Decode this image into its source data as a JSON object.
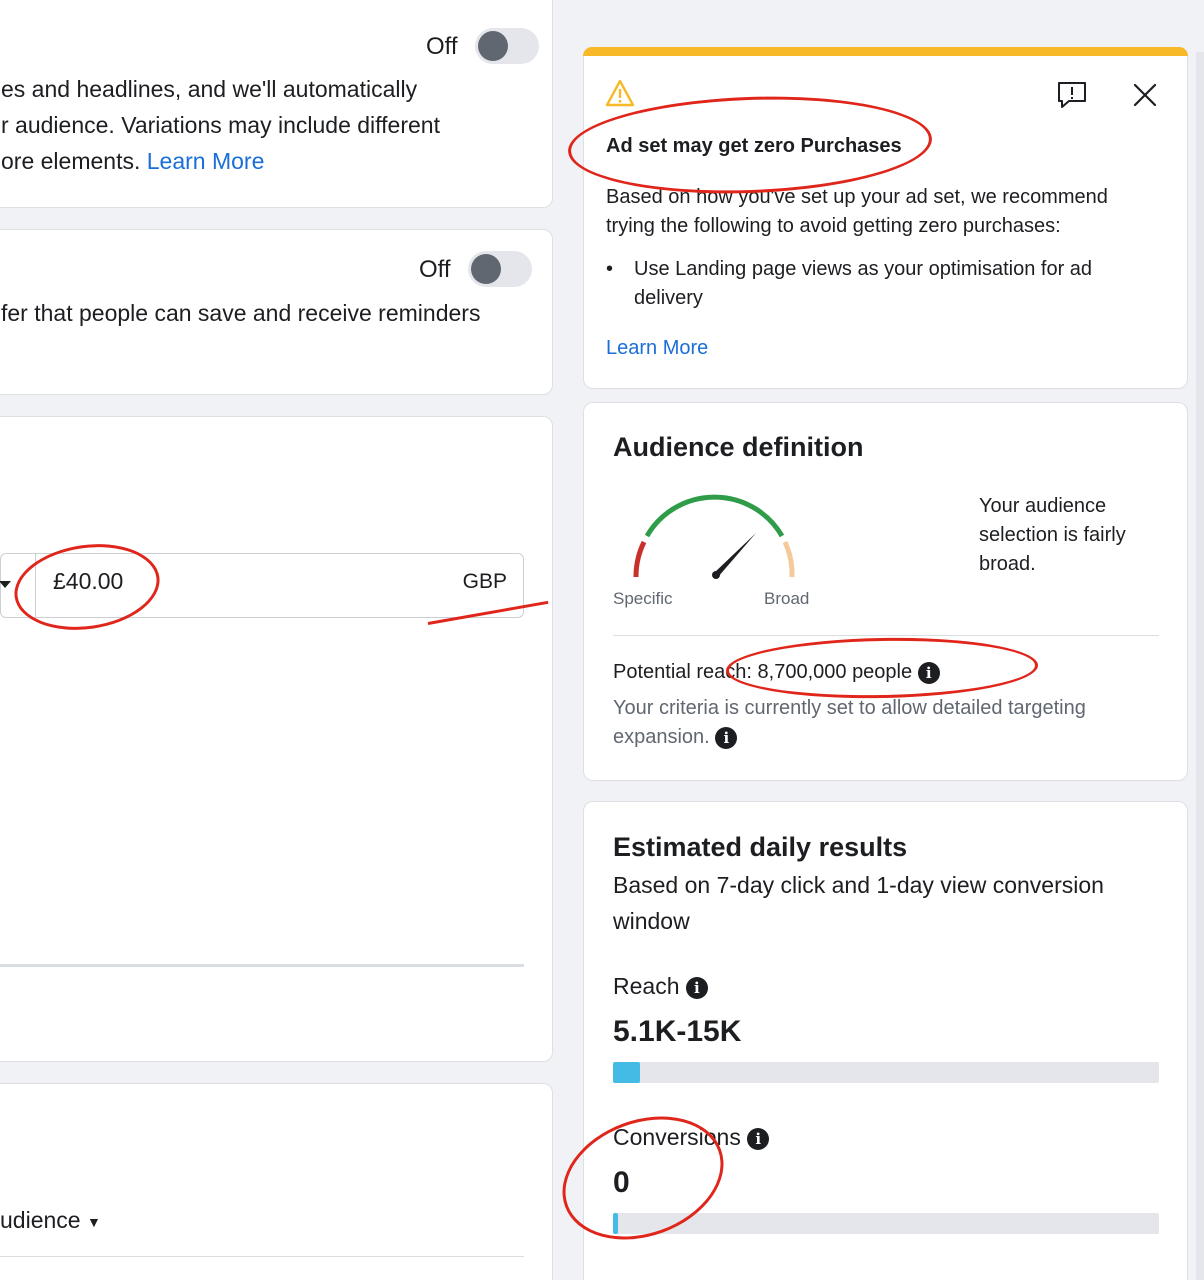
{
  "colors": {
    "accent": "#1877f2",
    "link": "#1a6ed8",
    "warning": "#f7b928",
    "annotation": "#e0261b",
    "bar_fill": "#44bbe5"
  },
  "dynamic_creative": {
    "toggle_label": "Off",
    "toggle_on": false,
    "line1": "es and headlines, and we'll automatically",
    "line2": "r audience. Variations may include different",
    "line3": "ore elements.",
    "learn_more": "Learn More"
  },
  "offer": {
    "toggle_label": "Off",
    "toggle_on": false,
    "line1": "fer that people can save and receive reminders"
  },
  "budget": {
    "value": "£40.00",
    "currency": "GBP"
  },
  "audience_section": {
    "dropdown_label": "udience"
  },
  "alert": {
    "icon": "warning-icon",
    "title": "Ad set may get zero Purchases",
    "body_line1": "Based on how you've set up your ad set, we recommend",
    "body_line2": "trying the following to avoid getting zero purchases:",
    "bullet_line1": "Use Landing page views as your optimisation for ad",
    "bullet_line2": "delivery",
    "learn_more": "Learn More"
  },
  "audience_definition": {
    "title": "Audience definition",
    "gauge": {
      "specific_label": "Specific",
      "broad_label": "Broad",
      "level": 0.75
    },
    "description_line1": "Your audience",
    "description_line2": "selection is fairly",
    "description_line3": "broad.",
    "potential_reach": "Potential reach: 8,700,000 people",
    "criteria_line1": "Your criteria is currently set to allow detailed targeting",
    "criteria_line2": "expansion."
  },
  "estimated_daily_results": {
    "title": "Estimated daily results",
    "subtitle_line1": "Based on 7-day click and 1-day view conversion",
    "subtitle_line2": "window",
    "reach_label": "Reach",
    "reach_value": "5.1K-15K",
    "reach_fraction": 0.05,
    "conversions_label": "Conversions",
    "conversions_value": "0",
    "conversions_fraction": 0.01
  }
}
